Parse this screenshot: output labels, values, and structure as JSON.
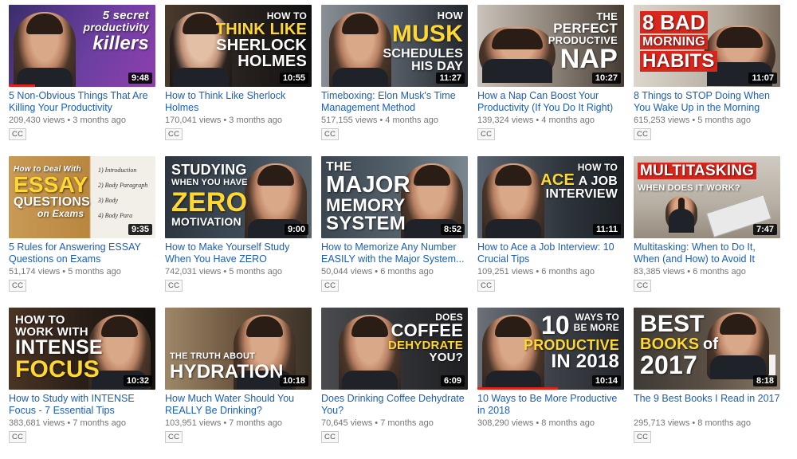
{
  "videos": [
    {
      "title": "5 Non-Obvious Things That Are Killing Your Productivity",
      "views": "209,430 views",
      "age": "3 months ago",
      "duration": "9:48",
      "cc": "CC",
      "watched": 0.18,
      "thumb_lines": [
        "5 secret",
        "productivity",
        "killers"
      ]
    },
    {
      "title": "How to Think Like Sherlock Holmes",
      "views": "170,041 views",
      "age": "3 months ago",
      "duration": "10:55",
      "cc": "CC",
      "thumb_lines": [
        "HOW TO",
        "THINK LIKE",
        "SHERLOCK",
        "HOLMES"
      ]
    },
    {
      "title": "Timeboxing: Elon Musk's Time Management Method",
      "views": "517,155 views",
      "age": "4 months ago",
      "duration": "11:27",
      "cc": "CC",
      "thumb_lines": [
        "HOW",
        "MUSK",
        "SCHEDULES",
        "HIS DAY"
      ]
    },
    {
      "title": "How a Nap Can Boost Your Productivity (If You Do It Right)",
      "views": "139,324 views",
      "age": "4 months ago",
      "duration": "10:27",
      "cc": "CC",
      "thumb_lines": [
        "THE",
        "PERFECT",
        "PRODUCTIVE",
        "NAP"
      ]
    },
    {
      "title": "8 Things to STOP Doing When You Wake Up in the Morning",
      "views": "615,253 views",
      "age": "5 months ago",
      "duration": "11:07",
      "cc": "CC",
      "thumb_lines": [
        "8 BAD",
        "MORNING",
        "HABITS"
      ]
    },
    {
      "title": "5 Rules for Answering ESSAY Questions on Exams",
      "views": "51,174 views",
      "age": "5 months ago",
      "duration": "9:35",
      "cc": "CC",
      "thumb_lines": [
        "How to Deal With",
        "ESSAY",
        "QUESTIONS",
        "on Exams"
      ],
      "notes": [
        "1) Introduction",
        "2) Body Paragraph",
        "3) Body",
        "4) Body Para"
      ]
    },
    {
      "title": "How to Make Yourself Study When You Have ZERO Motivation",
      "views": "742,031 views",
      "age": "5 months ago",
      "duration": "9:00",
      "cc": "CC",
      "thumb_lines": [
        "STUDYING",
        "WHEN YOU HAVE",
        "ZERO",
        "MOTIVATION"
      ]
    },
    {
      "title": "How to Memorize Any Number EASILY with the Major System...",
      "views": "50,044 views",
      "age": "6 months ago",
      "duration": "8:52",
      "cc": "CC",
      "thumb_lines": [
        "THE",
        "MAJOR",
        "MEMORY",
        "SYSTEM"
      ]
    },
    {
      "title": "How to Ace a Job Interview: 10 Crucial Tips",
      "views": "109,251 views",
      "age": "6 months ago",
      "duration": "11:11",
      "cc": "CC",
      "thumb_lines": [
        "HOW TO",
        "ACE",
        "A JOB",
        "INTERVIEW"
      ]
    },
    {
      "title": "Multitasking: When to Do It, When (and How) to Avoid It",
      "views": "83,385 views",
      "age": "6 months ago",
      "duration": "7:47",
      "cc": "CC",
      "thumb_lines": [
        "MULTITASKING",
        "WHEN DOES IT WORK?"
      ]
    },
    {
      "title": "How to Study with INTENSE Focus - 7 Essential Tips",
      "views": "383,681 views",
      "age": "7 months ago",
      "duration": "10:32",
      "cc": "CC",
      "thumb_lines": [
        "HOW TO",
        "WORK WITH",
        "INTENSE",
        "FOCUS"
      ]
    },
    {
      "title": "How Much Water Should You REALLY Be Drinking?",
      "views": "103,951 views",
      "age": "7 months ago",
      "duration": "10:18",
      "cc": "CC",
      "thumb_lines": [
        "THE TRUTH ABOUT",
        "HYDRATION"
      ]
    },
    {
      "title": "Does Drinking Coffee Dehydrate You?",
      "views": "70,645 views",
      "age": "7 months ago",
      "duration": "6:09",
      "cc": "CC",
      "thumb_lines": [
        "DOES",
        "COFFEE",
        "DEHYDRATE",
        "YOU?"
      ]
    },
    {
      "title": "10 Ways to Be More Productive in 2018",
      "views": "308,290 views",
      "age": "8 months ago",
      "duration": "10:14",
      "cc": "CC",
      "watched": 0.55,
      "thumb_lines": [
        "10",
        "WAYS TO",
        "BE MORE",
        "PRODUCTIVE",
        "IN 2018"
      ]
    },
    {
      "title": "The 9 Best Books I Read in 2017",
      "views": "295,713 views",
      "age": "8 months ago",
      "duration": "8:18",
      "cc": "CC",
      "thumb_lines": [
        "BEST",
        "BOOKS",
        "of",
        "2017"
      ]
    }
  ],
  "colors": {
    "link": "#1a5ebd",
    "meta": "#767676",
    "accent_yellow": "#ffd731",
    "accent_red": "#d9261c",
    "progress": "#e62117"
  }
}
